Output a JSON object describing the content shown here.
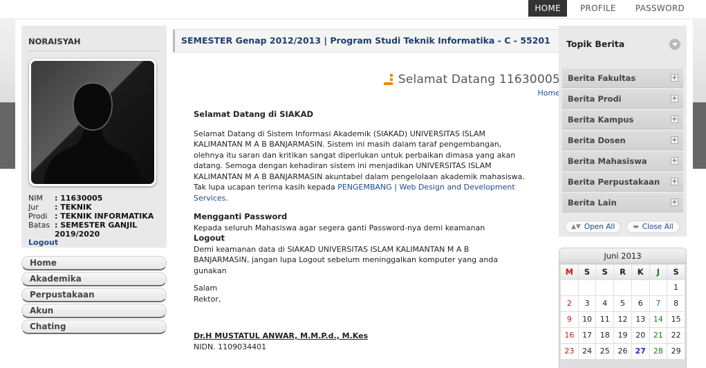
{
  "topnav": [
    "HOME",
    "PROFILE",
    "PASSWORD"
  ],
  "profile": {
    "name": "NORAISYAH",
    "fields": [
      {
        "key": "NIM",
        "value": ": 11630005"
      },
      {
        "key": "Jur",
        "value": ": TEKNIK"
      },
      {
        "key": "Prodi",
        "value": ": TEKNIK INFORMATIKA"
      },
      {
        "key": "Batas",
        "value": ": SEMESTER GANJIL 2019/2020"
      }
    ],
    "logout": "Logout"
  },
  "menu": [
    "Home",
    "Akademika",
    "Perpustakaan",
    "Akun",
    "Chating"
  ],
  "header": {
    "semester": "SEMESTER Genap 2012/2013 | Program Studi Teknik Informatika - C - 55201"
  },
  "welcome": {
    "title": "Selamat Datang 11630005",
    "breadcrumb": "Home",
    "heading": "Selamat Datang di SIAKAD",
    "para1": "Selamat Datang di Sistem Informasi Akademik (SIAKAD) UNIVERSITAS ISLAM KALIMANTAN M A B BANJARMASIN. Sistem ini masih dalam taraf pengembangan, olehnya itu saran dan kritikan sangat diperlukan untuk perbaikan dimasa yang akan datang. Semoga dengan kehadiran sistem ini menjadikan UNIVERSITAS ISLAM KALIMANTAN M A B BANJARMASIN akuntabel dalam pengelolaan akademik mahasiswa. Tak lupa ucapan terima kasih kepada",
    "para1_link": "PENGEMBANG | Web Design and Development Services.",
    "pw_title": "Mengganti Password",
    "pw_text": "Kepada seluruh Mahasiswa agar segera ganti Password-nya demi keamanan",
    "logout_title": "Logout",
    "logout_text": "Demi keamanan data di SIAKAD UNIVERSITAS ISLAM KALIMANTAN M A B BANJARMASIN, jangan lupa Logout sebelum meninggalkan komputer yang anda gunakan",
    "salam": "Salam",
    "rektor": "Rektor,",
    "signer": "Dr.H MUSTATUL ANWAR, M.M.P.d., M.Kes",
    "nidn": "NIDN. 1109034401"
  },
  "topik": {
    "title": "Topik Berita",
    "items": [
      "Berita Fakultas",
      "Berita Prodi",
      "Berita Kampus",
      "Berita Dosen",
      "Berita Mahasiswa",
      "Berita Perpustakaan",
      "Berita Lain"
    ],
    "open_all": "Open All",
    "close_all": "Close All"
  },
  "calendar": {
    "title": "Juni 2013",
    "days": [
      "M",
      "S",
      "S",
      "R",
      "K",
      "J",
      "S"
    ],
    "weeks": [
      [
        "",
        "",
        "",
        "",
        "",
        "",
        "1"
      ],
      [
        "2",
        "3",
        "4",
        "5",
        "6",
        "7",
        "8"
      ],
      [
        "9",
        "10",
        "11",
        "12",
        "13",
        "14",
        "15"
      ],
      [
        "16",
        "17",
        "18",
        "19",
        "20",
        "21",
        "22"
      ],
      [
        "23",
        "24",
        "25",
        "26",
        "27",
        "28",
        "29"
      ]
    ],
    "today": "27"
  }
}
